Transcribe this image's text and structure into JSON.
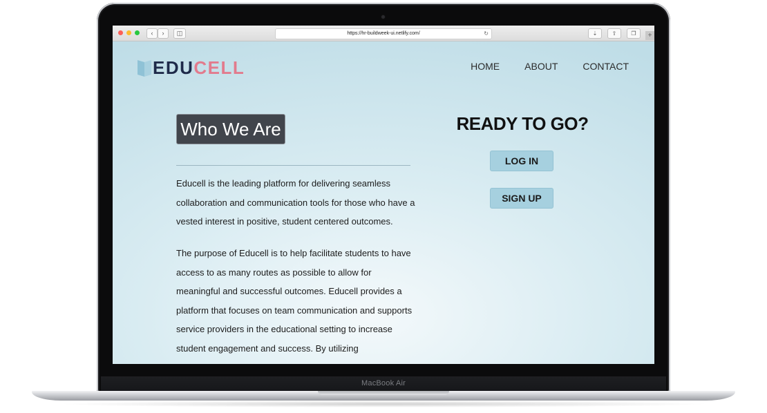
{
  "device": {
    "model_label": "MacBook Air"
  },
  "browser": {
    "url": "https://hr-buildweek-ui.netlify.com/",
    "back_icon": "chevron-left-icon",
    "forward_icon": "chevron-right-icon",
    "sidebar_icon": "sidebar-icon",
    "reload_icon": "reload-icon",
    "download_icon": "download-icon",
    "share_icon": "share-icon",
    "tabs_icon": "tabs-icon",
    "new_tab_icon": "plus-icon"
  },
  "site": {
    "logo": {
      "part1": "EDU",
      "part2": "CELL"
    },
    "nav": [
      {
        "label": "HOME"
      },
      {
        "label": "ABOUT"
      },
      {
        "label": "CONTACT"
      }
    ],
    "about": {
      "title": "Who We Are",
      "paragraph1": "Educell is the leading platform for delivering seamless collaboration and communication tools for those who have a vested interest in positive, student centered outcomes.",
      "paragraph2": "The purpose of Educell is to help facilitate students to have access to as many routes as possible to allow for meaningful and successful outcomes. Educell provides a platform that focuses on team communication and supports service providers in the educational setting to increase student engagement and success. By utilizing"
    },
    "cta": {
      "heading": "READY TO GO?",
      "login_label": "LOG IN",
      "signup_label": "SIGN UP"
    },
    "colors": {
      "logo_dark": "#1e2a4a",
      "logo_accent": "#e27b8d",
      "button_bg": "#a6d0df",
      "title_box_bg": "#41454c",
      "page_bg": "#bfdde7"
    }
  }
}
